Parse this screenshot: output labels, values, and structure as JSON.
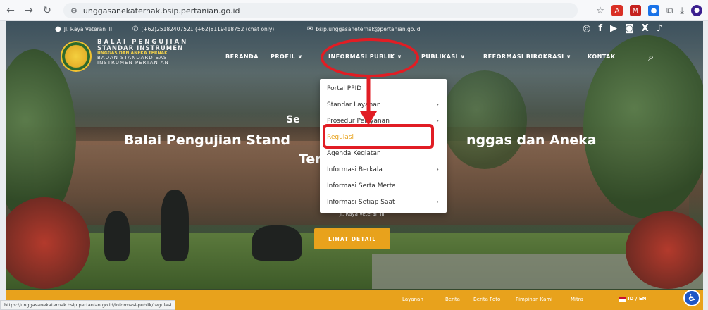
{
  "browser": {
    "url": "unggasanekaternak.bsip.pertanian.go.id",
    "status_url": "https://unggasanekaternak.bsip.pertanian.go.id/informasi-publik/regulasi"
  },
  "topbar": {
    "location": "Jl. Raya Veteran III",
    "phone": "(+62)25182407521 (+62)8119418752 (chat only)",
    "email": "bsip.unggasaneternak@pertanian.go.id"
  },
  "logo": {
    "line1": "BALAI PENGUJIAN",
    "line2": "STANDAR INSTRUMEN",
    "line3": "UNGGAS DAN ANEKA TERNAK",
    "line4": "BADAN STANDARDISASI",
    "line5": "INSTRUMEN PERTANIAN"
  },
  "nav": {
    "beranda": "BERANDA",
    "profil": "PROFIL ∨",
    "informasi_publik": "INFORMASI PUBLIK ∨",
    "publikasi": "PUBLIKASI ∨",
    "reformasi": "REFORMASI BIROKRASI ∨",
    "kontak": "KONTAK"
  },
  "dropdown": {
    "items": [
      {
        "label": "Portal PPID"
      },
      {
        "label": "Standar Layanan"
      },
      {
        "label": "Prosedur Pelayanan"
      },
      {
        "label": "Regulasi"
      },
      {
        "label": "Agenda Kegiatan"
      },
      {
        "label": "Informasi Berkala"
      },
      {
        "label": "Informasi Serta Merta"
      },
      {
        "label": "Informasi Setiap Saat"
      }
    ]
  },
  "hero": {
    "line1": "Se",
    "line2_left": "Balai Pengujian Stand",
    "line2_right": "nggas dan Aneka",
    "line3": "Terr",
    "small": "Jl. Raya Veteran III",
    "button": "LIHAT DETAIL"
  },
  "footer_bar": {
    "links": [
      "Layanan",
      "Berita",
      "Berita Foto",
      "Pimpinan Kami",
      "Mitra"
    ],
    "lang": "ID / EN"
  },
  "colors": {
    "accent": "#e8a21c",
    "annotation": "#e11d24"
  }
}
